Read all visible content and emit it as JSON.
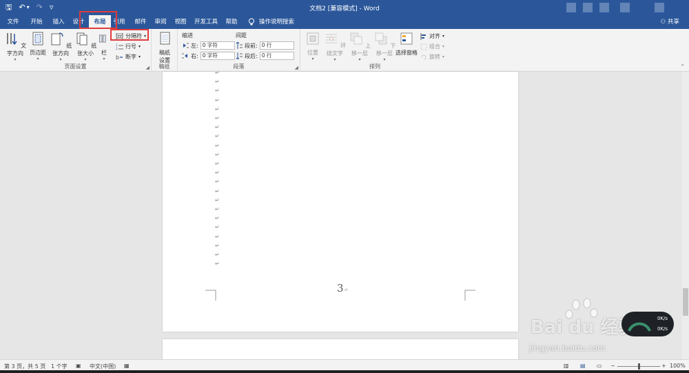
{
  "titlebar": {
    "doc_title": "文档2 [兼容模式] - Word",
    "qat": {
      "save": "🖫",
      "undo": "↶",
      "undo_caret": "▾",
      "redo": "↷",
      "customize": "▿"
    }
  },
  "tabs": [
    {
      "key": "file",
      "label": "文件"
    },
    {
      "key": "home",
      "label": "开始"
    },
    {
      "key": "insert",
      "label": "插入"
    },
    {
      "key": "design",
      "label": "设计"
    },
    {
      "key": "layout",
      "label": "布局"
    },
    {
      "key": "references",
      "label": "引用"
    },
    {
      "key": "mailings",
      "label": "邮件"
    },
    {
      "key": "review",
      "label": "审阅"
    },
    {
      "key": "view",
      "label": "视图"
    },
    {
      "key": "developer",
      "label": "开发工具"
    },
    {
      "key": "help",
      "label": "帮助"
    }
  ],
  "tell_me": "操作说明搜索",
  "share": "共享",
  "ribbon": {
    "page_setup": {
      "label": "页面设置",
      "text_direction": "文字方向",
      "margins": "页边距",
      "orientation": "纸张方向",
      "size": "纸张大小",
      "columns": "栏",
      "breaks": "分隔符",
      "line_numbers": "行号",
      "hyphenation": "断字"
    },
    "manuscript": {
      "label": "稿纸",
      "setup_line1": "稿纸",
      "setup_line2": "设置"
    },
    "paragraph": {
      "label": "段落",
      "indent_title": "缩进",
      "spacing_title": "间距",
      "left_label": "左:",
      "left_value": "0 字符",
      "right_label": "右:",
      "right_value": "0 字符",
      "before_label": "段前:",
      "before_value": "0 行",
      "after_label": "段后:",
      "after_value": "0 行"
    },
    "arrange": {
      "label": "排列",
      "position": "位置",
      "wrap_text": "环绕文字",
      "bring_forward": "上移一层",
      "send_backward": "下移一层",
      "selection_pane": "选择窗格",
      "align": "对齐",
      "group": "组合",
      "rotate": "旋转"
    }
  },
  "document": {
    "paragraph_mark": "↵",
    "page_number": "3"
  },
  "status": {
    "page": "第 3 页，共 5 页",
    "words": "1 个字",
    "language": "中文(中国)",
    "zoom": "100%"
  },
  "watermark": {
    "brand": "Bai du 经验",
    "url": "jingyan.baidu.com"
  },
  "net_widget": {
    "up": "0K/s",
    "down": "0K/s"
  },
  "colors": {
    "accent": "#2b579a",
    "highlight": "#e03b3b"
  }
}
